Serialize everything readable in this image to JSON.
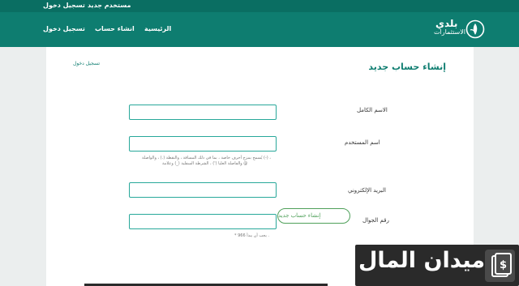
{
  "topbar": {
    "new_user": "مستخدم جديد",
    "login": "تسجيل دخول"
  },
  "navbar": {
    "home": "الرئيسية",
    "create_account": "انشاء حساب",
    "login": "تسجيل دخول"
  },
  "logo": {
    "line1": "بلدي",
    "line2": "الاستثمارات"
  },
  "form": {
    "title": "إنشاء حساب جديد",
    "login_link": "تسجيل دخول",
    "full_name_label": "الاسم الكامل",
    "username_label": "اسم المستخدم",
    "username_hint_1": "يُسمح بمزج أحرف خاصة ، بما في ذلك المسافة ، والنقطة (.) ، والواصلة (-) ،",
    "username_hint_2": "والفاصلة العليا (') ، الشرطة السفلية (_) وعلامة @",
    "email_label": "البريد الإلكتروني",
    "phone_label": "رقم الجوال",
    "phone_hint": "* يجب أن يبدأ 966 .",
    "submit_label": "إنشاء حساب جديد"
  },
  "watermark": {
    "text": "ميدان المال"
  }
}
